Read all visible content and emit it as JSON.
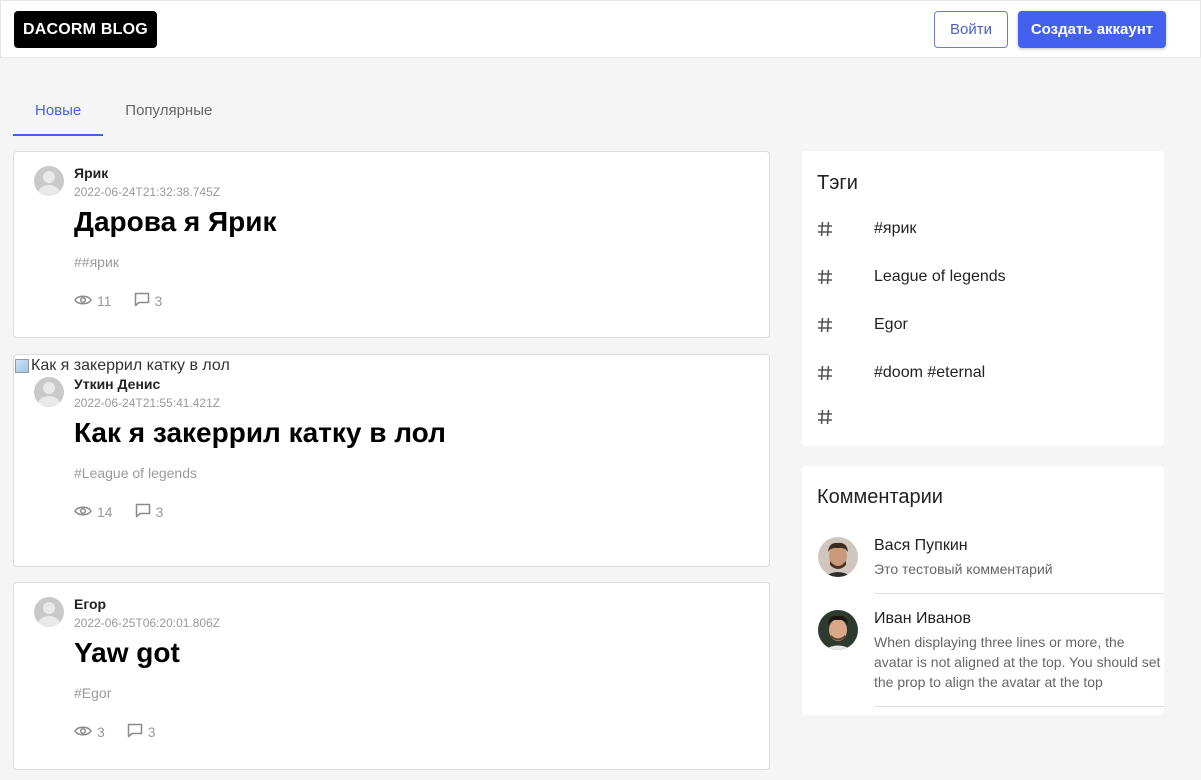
{
  "header": {
    "logo": "DACORM BLOG",
    "login_label": "Войти",
    "register_label": "Создать аккаунт"
  },
  "tabs": [
    {
      "label": "Новые",
      "active": true
    },
    {
      "label": "Популярные",
      "active": false
    }
  ],
  "posts": [
    {
      "author": "Ярик",
      "date": "2022-06-24T21:32:38.745Z",
      "title": "Дарова я Ярик",
      "tag": "##ярик",
      "views": "11",
      "comments": "3",
      "image_alt": ""
    },
    {
      "author": "Уткин Денис",
      "date": "2022-06-24T21:55:41.421Z",
      "title": "Как я закеррил катку в лол",
      "tag": "#League of legends",
      "views": "14",
      "comments": "3",
      "image_alt": "Как я закеррил катку в лол"
    },
    {
      "author": "Егор",
      "date": "2022-06-25T06:20:01.806Z",
      "title": "Yaw got",
      "tag": "#Egor",
      "views": "3",
      "comments": "3",
      "image_alt": ""
    }
  ],
  "tags_panel": {
    "title": "Тэги",
    "items": [
      "#ярик",
      "League of legends",
      "Egor",
      "#doom #eternal",
      ""
    ]
  },
  "comments_panel": {
    "title": "Комментарии",
    "items": [
      {
        "name": "Вася Пупкин",
        "text": "Это тестовый комментарий"
      },
      {
        "name": "Иван Иванов",
        "text": "When displaying three lines or more, the avatar is not aligned at the top. You should set the prop to align the avatar at the top"
      }
    ]
  },
  "colors": {
    "accent": "#4361ee",
    "logo_bg": "#000000",
    "page_bg": "#f5f5f5"
  },
  "icons": {
    "views": "eye-icon",
    "comments": "comment-bubble-icon",
    "tag": "hash-icon"
  }
}
